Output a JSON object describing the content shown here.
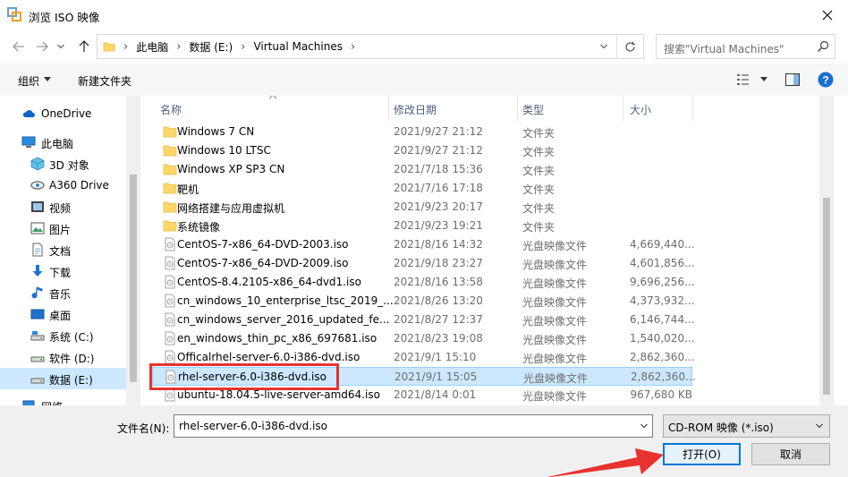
{
  "window": {
    "title": "浏览 ISO 映像"
  },
  "nav": {
    "breadcrumb": [
      "此电脑",
      "数据 (E:)",
      "Virtual Machines"
    ],
    "search_placeholder": "搜索\"Virtual Machines\""
  },
  "toolbar": {
    "organize": "组织",
    "new_folder": "新建文件夹"
  },
  "sidebar": {
    "items": [
      {
        "label": "OneDrive",
        "icon": "cloud-icon"
      },
      {
        "label": "此电脑",
        "icon": "computer-icon"
      },
      {
        "label": "3D 对象",
        "icon": "cube-icon"
      },
      {
        "label": "A360 Drive",
        "icon": "drive-icon"
      },
      {
        "label": "视频",
        "icon": "video-icon"
      },
      {
        "label": "图片",
        "icon": "picture-icon"
      },
      {
        "label": "文档",
        "icon": "document-icon"
      },
      {
        "label": "下载",
        "icon": "download-icon"
      },
      {
        "label": "音乐",
        "icon": "music-icon"
      },
      {
        "label": "桌面",
        "icon": "desktop-icon"
      },
      {
        "label": "系统 (C:)",
        "icon": "disk-icon"
      },
      {
        "label": "软件 (D:)",
        "icon": "disk-icon"
      },
      {
        "label": "数据 (E:)",
        "icon": "disk-icon"
      },
      {
        "label": "网络",
        "icon": "network-icon"
      }
    ]
  },
  "columns": {
    "name": "名称",
    "date": "修改日期",
    "type": "类型",
    "size": "大小"
  },
  "files": [
    {
      "name": "Windows 7 CN",
      "date": "2021/9/27 21:12",
      "type": "文件夹",
      "size": "",
      "kind": "folder"
    },
    {
      "name": "Windows 10 LTSC",
      "date": "2021/9/27 21:12",
      "type": "文件夹",
      "size": "",
      "kind": "folder"
    },
    {
      "name": "Windows XP SP3 CN",
      "date": "2021/7/18 15:36",
      "type": "文件夹",
      "size": "",
      "kind": "folder"
    },
    {
      "name": "靶机",
      "date": "2021/7/16 17:18",
      "type": "文件夹",
      "size": "",
      "kind": "folder"
    },
    {
      "name": "网络搭建与应用虚拟机",
      "date": "2021/9/23 20:17",
      "type": "文件夹",
      "size": "",
      "kind": "folder"
    },
    {
      "name": "系统镜像",
      "date": "2021/9/23 19:21",
      "type": "文件夹",
      "size": "",
      "kind": "folder"
    },
    {
      "name": "CentOS-7-x86_64-DVD-2003.iso",
      "date": "2021/8/16 14:32",
      "type": "光盘映像文件",
      "size": "4,669,440...",
      "kind": "iso"
    },
    {
      "name": "CentOS-7-x86_64-DVD-2009.iso",
      "date": "2021/9/18 23:27",
      "type": "光盘映像文件",
      "size": "4,601,856...",
      "kind": "iso"
    },
    {
      "name": "CentOS-8.4.2105-x86_64-dvd1.iso",
      "date": "2021/8/16 13:58",
      "type": "光盘映像文件",
      "size": "9,696,256...",
      "kind": "iso"
    },
    {
      "name": "cn_windows_10_enterprise_ltsc_2019_...",
      "date": "2021/8/26 13:20",
      "type": "光盘映像文件",
      "size": "4,373,932...",
      "kind": "iso"
    },
    {
      "name": "cn_windows_server_2016_updated_fe...",
      "date": "2021/8/27 12:37",
      "type": "光盘映像文件",
      "size": "6,146,744...",
      "kind": "iso"
    },
    {
      "name": "en_windows_thin_pc_x86_697681.iso",
      "date": "2021/8/23 19:08",
      "type": "光盘映像文件",
      "size": "1,540,020...",
      "kind": "iso"
    },
    {
      "name": "Officalrhel-server-6.0-i386-dvd.iso",
      "date": "2021/9/1 15:10",
      "type": "光盘映像文件",
      "size": "2,862,360...",
      "kind": "iso"
    },
    {
      "name": "rhel-server-6.0-i386-dvd.iso",
      "date": "2021/9/1 15:05",
      "type": "光盘映像文件",
      "size": "2,862,360...",
      "kind": "iso"
    },
    {
      "name": "ubuntu-18.04.5-live-server-amd64.iso",
      "date": "2021/8/14 0:01",
      "type": "光盘映像文件",
      "size": "967,680 KB",
      "kind": "iso"
    }
  ],
  "footer": {
    "filename_label": "文件名(N):",
    "filename_value": "rhel-server-6.0-i386-dvd.iso",
    "filetype_value": "CD-ROM 映像 (*.iso)",
    "open_label": "打开(O)",
    "cancel_label": "取消"
  },
  "colors": {
    "selection": "#cce8ff",
    "accent": "#0078d7",
    "highlight": "#e8322f"
  }
}
